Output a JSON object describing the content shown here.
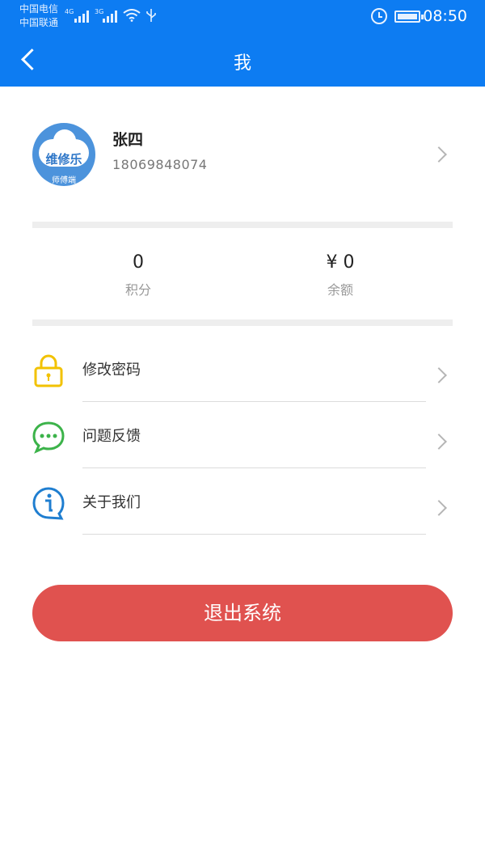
{
  "status_bar": {
    "carrier_1": "中国电信",
    "carrier_2": "中国联通",
    "net_1": "4G",
    "net_2": "3G",
    "time": "08:50"
  },
  "nav": {
    "title": "我"
  },
  "profile": {
    "avatar_logo_text": "维修乐",
    "avatar_sub_text": "师傅端",
    "name": "张四",
    "phone": "18069848074"
  },
  "stats": {
    "points_value": "0",
    "points_label": "积分",
    "balance_value": "¥ 0",
    "balance_label": "余额"
  },
  "menu": [
    {
      "label": "修改密码",
      "icon": "lock-icon",
      "color": "#f2c200"
    },
    {
      "label": "问题反馈",
      "icon": "chat-bubble-icon",
      "color": "#3cb34a"
    },
    {
      "label": "关于我们",
      "icon": "info-icon",
      "color": "#1f7ed0"
    }
  ],
  "logout_label": "退出系统",
  "colors": {
    "primary": "#0d7cf2",
    "logout": "#e0524f"
  }
}
